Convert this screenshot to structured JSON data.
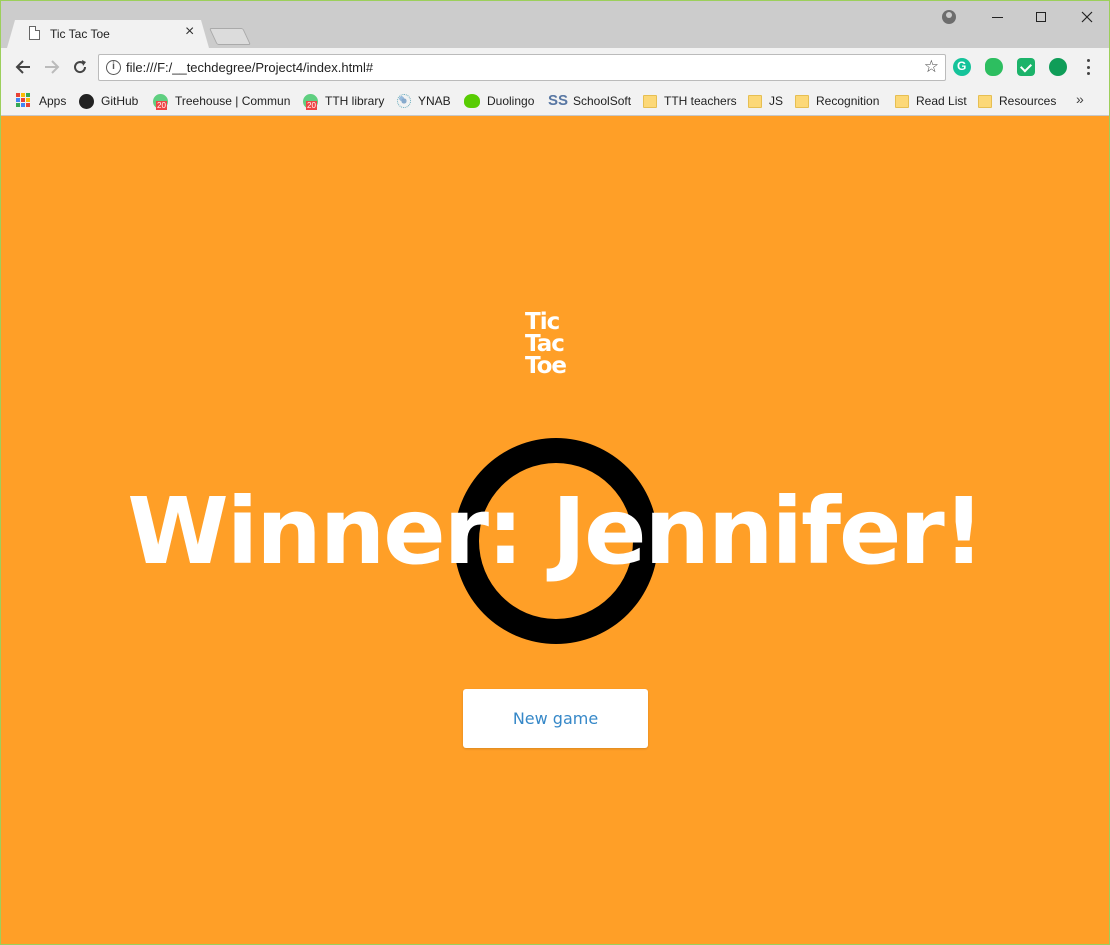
{
  "browser": {
    "tab_title": "Tic Tac Toe",
    "tab_close": "×",
    "url": "file:///F:/__techdegree/Project4/index.html#",
    "bookmarks": [
      {
        "label": "Apps",
        "icon": "apps-grid-icon"
      },
      {
        "label": "GitHub",
        "icon": "github-icon"
      },
      {
        "label": "Treehouse | Commun",
        "icon": "treehouse-icon"
      },
      {
        "label": "TTH library",
        "icon": "treehouse-icon"
      },
      {
        "label": "YNAB",
        "icon": "ynab-icon"
      },
      {
        "label": "Duolingo",
        "icon": "duolingo-icon"
      },
      {
        "label": "SchoolSoft",
        "icon": "schoolsoft-icon"
      },
      {
        "label": "TTH teachers",
        "icon": "folder-icon"
      },
      {
        "label": "JS",
        "icon": "folder-icon"
      },
      {
        "label": "Recognition",
        "icon": "folder-icon"
      },
      {
        "label": "Read List",
        "icon": "folder-icon"
      },
      {
        "label": "Resources",
        "icon": "folder-icon"
      }
    ],
    "bookmarks_more": "»",
    "schoolsoft_glyph": "SS"
  },
  "game": {
    "logo_lines": [
      "Tic",
      "Tac",
      "Toe"
    ],
    "winner_text": "Winner: Jennifer!",
    "new_game_label": "New game",
    "background_color": "#ff9f27",
    "winner_symbol": "O"
  }
}
